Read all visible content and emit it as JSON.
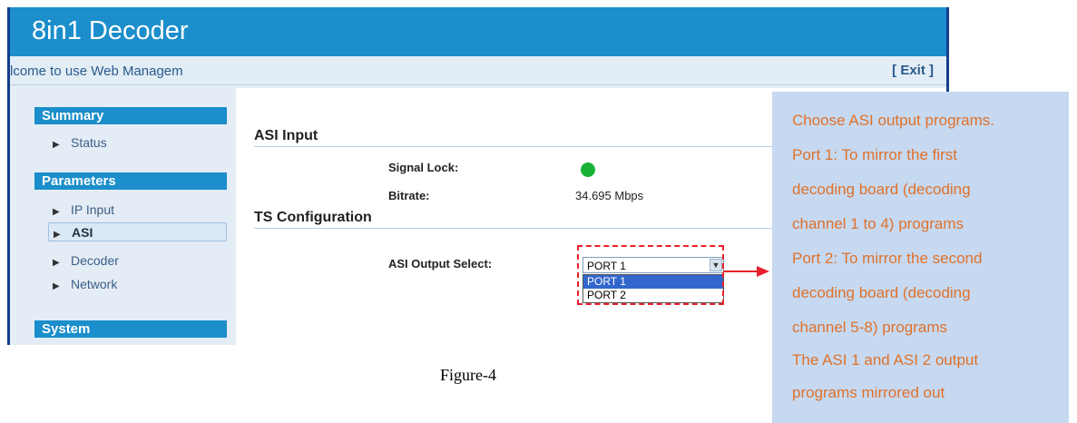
{
  "header": {
    "title": "8in1 Decoder"
  },
  "welcome_bar": {
    "text": "lcome to use Web Managem",
    "exit_label": "[ Exit ]"
  },
  "sidebar": {
    "sections": [
      {
        "title": "Summary",
        "items": [
          {
            "label": "Status"
          }
        ]
      },
      {
        "title": "Parameters",
        "items": [
          {
            "label": "IP Input"
          },
          {
            "label": "ASI",
            "active": true
          },
          {
            "label": "Decoder"
          },
          {
            "label": "Network"
          }
        ]
      },
      {
        "title": "System",
        "items": []
      }
    ]
  },
  "main": {
    "asi_input": {
      "title": "ASI Input",
      "signal_lock_label": "Signal Lock:",
      "signal_lock_status": "locked",
      "bitrate_label": "Bitrate:",
      "bitrate_value": "34.695 Mbps"
    },
    "ts_config": {
      "title": "TS Configuration",
      "asi_output_label": "ASI Output Select:",
      "selected": "PORT 1",
      "options": [
        "PORT 1",
        "PORT 2"
      ]
    }
  },
  "callout": {
    "lines": [
      "Choose ASI output programs.",
      "Port 1: To mirror the first",
      "decoding board (decoding",
      "channel 1 to 4) programs",
      "Port 2: To mirror the second",
      "decoding board (decoding",
      "channel 5-8) programs",
      "The ASI 1 and ASI 2 output",
      "programs mirrored out"
    ]
  },
  "caption": "Figure-4",
  "colors": {
    "header": "#1b8ecb",
    "callout_text": "#e0712a",
    "callout_bg": "#c6d9f1",
    "annotation_red": "#e8212c",
    "signal_green": "#17b337"
  }
}
